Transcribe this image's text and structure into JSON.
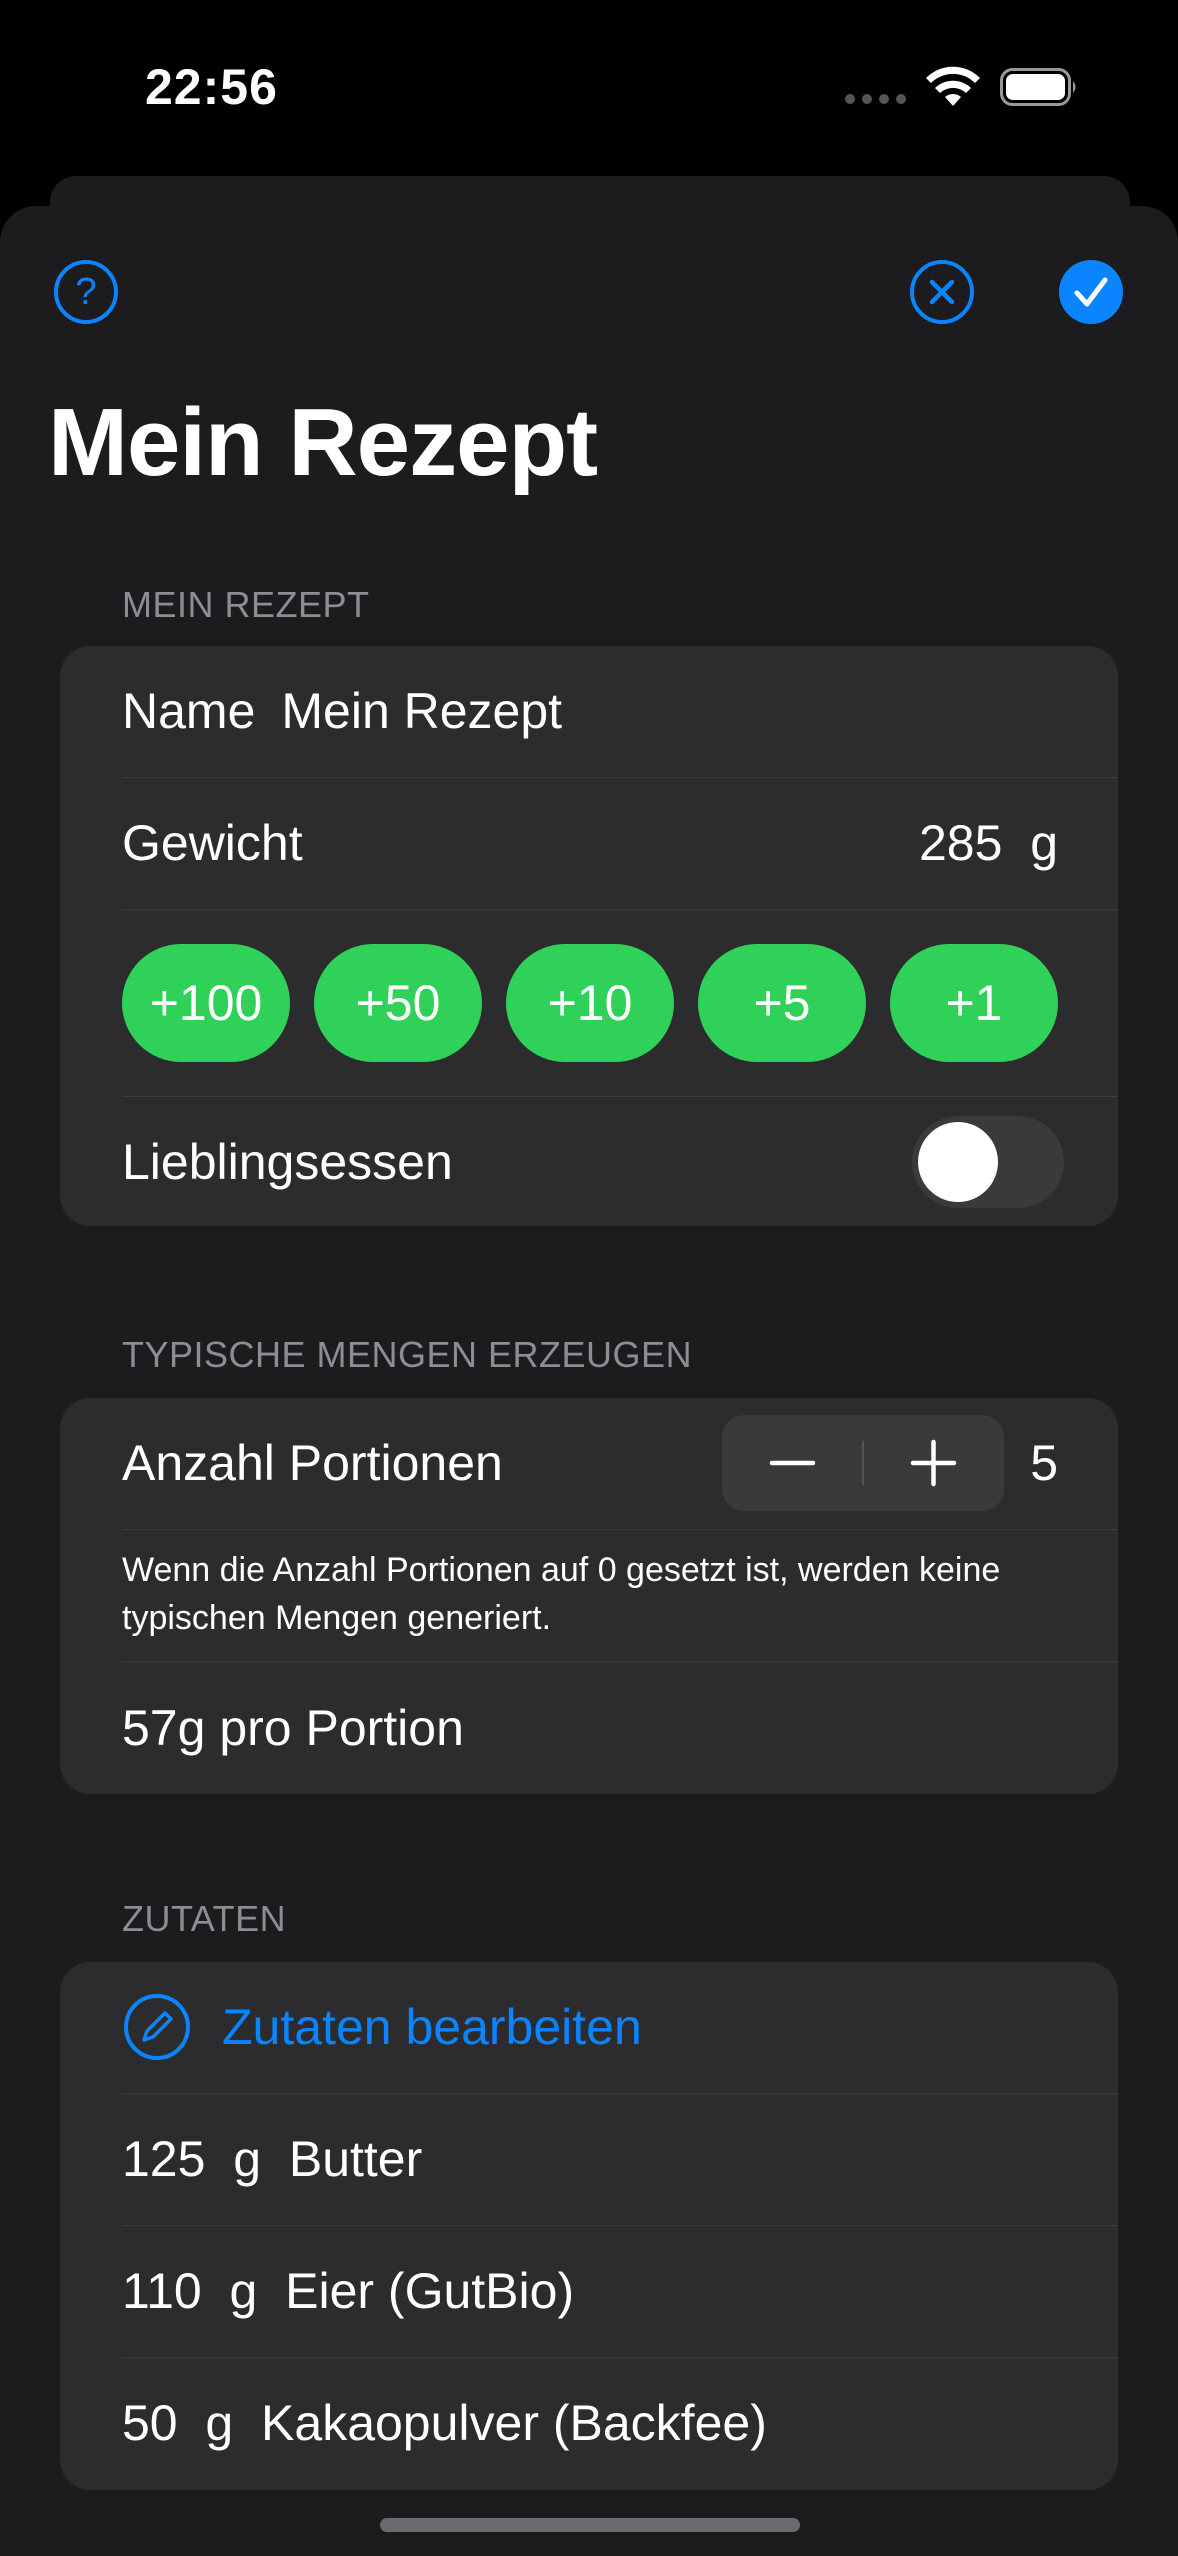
{
  "status_bar": {
    "time": "22:56"
  },
  "nav": {
    "title": "Mein Rezept",
    "help_glyph": "?"
  },
  "recipe_section": {
    "header": "MEIN REZEPT",
    "name_label": "Name",
    "name_value": "Mein Rezept",
    "weight_label": "Gewicht",
    "weight_value": "285",
    "weight_unit": "g",
    "quick_add": [
      "+100",
      "+50",
      "+10",
      "+5",
      "+1"
    ],
    "favorite_label": "Lieblingsessen",
    "favorite_on": false
  },
  "portions_section": {
    "header": "TYPISCHE MENGEN ERZEUGEN",
    "portions_label": "Anzahl Portionen",
    "portions_value": "5",
    "footnote": "Wenn die Anzahl Portionen auf 0 gesetzt ist, werden keine typischen Mengen generiert.",
    "per_portion": "57g pro Portion"
  },
  "ingredients_section": {
    "header": "ZUTATEN",
    "edit_label": "Zutaten bearbeiten",
    "items": [
      {
        "amount": "125",
        "unit": "g",
        "name": "Butter"
      },
      {
        "amount": "110",
        "unit": "g",
        "name": "Eier (GutBio)"
      },
      {
        "amount": "50",
        "unit": "g",
        "name": "Kakaopulver (Backfee)"
      }
    ]
  },
  "colors": {
    "accent": "#0a84ff",
    "quick_button": "#30d158",
    "cell_background": "#2c2c2e",
    "sheet_background": "#1c1c1e"
  }
}
